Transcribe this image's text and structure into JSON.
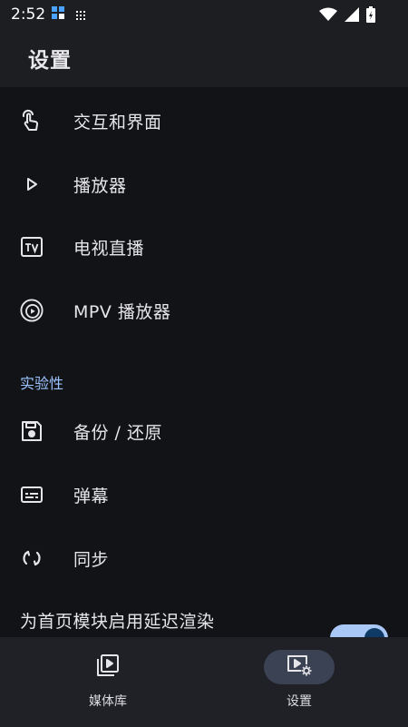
{
  "status_bar": {
    "time": "2:52"
  },
  "app_bar": {
    "title": "设置"
  },
  "menu_items": [
    {
      "label": "交互和界面",
      "icon": "touch-icon"
    },
    {
      "label": "播放器",
      "icon": "play-icon"
    },
    {
      "label": "电视直播",
      "icon": "tv-icon"
    },
    {
      "label": "MPV 播放器",
      "icon": "mpv-icon"
    }
  ],
  "section": {
    "label": "实验性"
  },
  "section_items": [
    {
      "label": "备份 / 还原",
      "icon": "save-icon"
    },
    {
      "label": "弹幕",
      "icon": "danmaku-icon"
    },
    {
      "label": "同步",
      "icon": "sync-icon"
    }
  ],
  "preference": {
    "label": "为首页模块启用延迟渲染",
    "enabled": true
  },
  "bottom_nav": [
    {
      "label": "媒体库",
      "icon": "media-library-icon",
      "active": false
    },
    {
      "label": "设置",
      "icon": "settings-icon",
      "active": true
    }
  ],
  "colors": {
    "accent": "#9cc4ff",
    "background": "#121317",
    "bar": "#1d1e22",
    "toggle": "#a9c8f6"
  }
}
